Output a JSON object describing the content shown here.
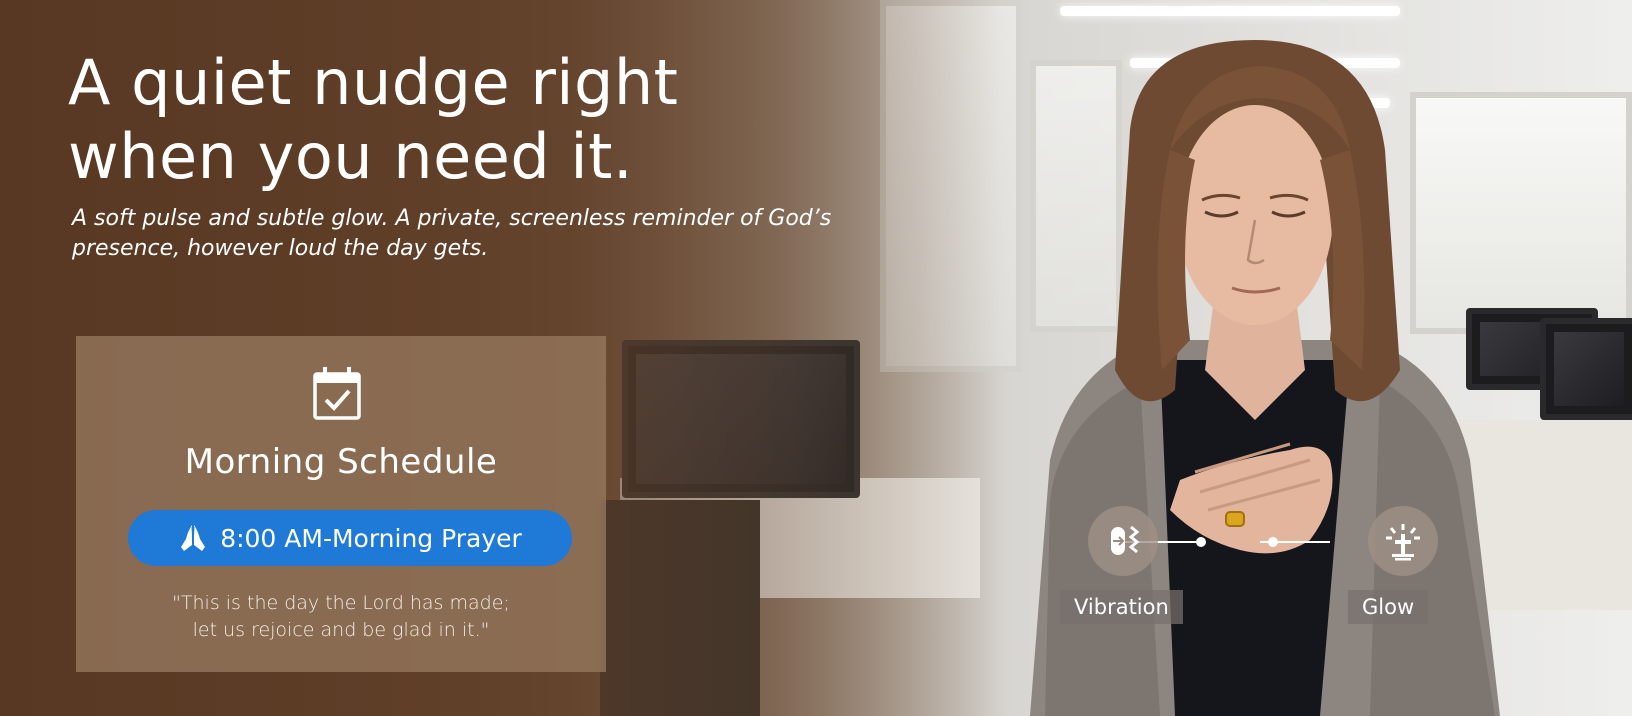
{
  "hero": {
    "headline_line1": "A quiet nudge right",
    "headline_line2": "when you need it.",
    "subtext_line1": "A soft pulse and subtle glow. A private, screenless reminder of God’s",
    "subtext_line2": "presence, however loud the day gets."
  },
  "schedule_card": {
    "icon": "calendar-check-icon",
    "title": "Morning Schedule",
    "event_icon": "praying-hands-icon",
    "event_label": "8:00 AM-Morning Prayer",
    "quote_line1": "\"This is the day the Lord has made;",
    "quote_line2": "let us rejoice and be glad in it.\""
  },
  "features": [
    {
      "icon": "vibration-icon",
      "label": "Vibration"
    },
    {
      "icon": "glow-icon",
      "label": "Glow"
    }
  ],
  "colors": {
    "accent_blue": "#1e7ad6",
    "brown_overlay": "#5a3a24",
    "card_bg": "#967860",
    "text_white": "#ffffff"
  }
}
